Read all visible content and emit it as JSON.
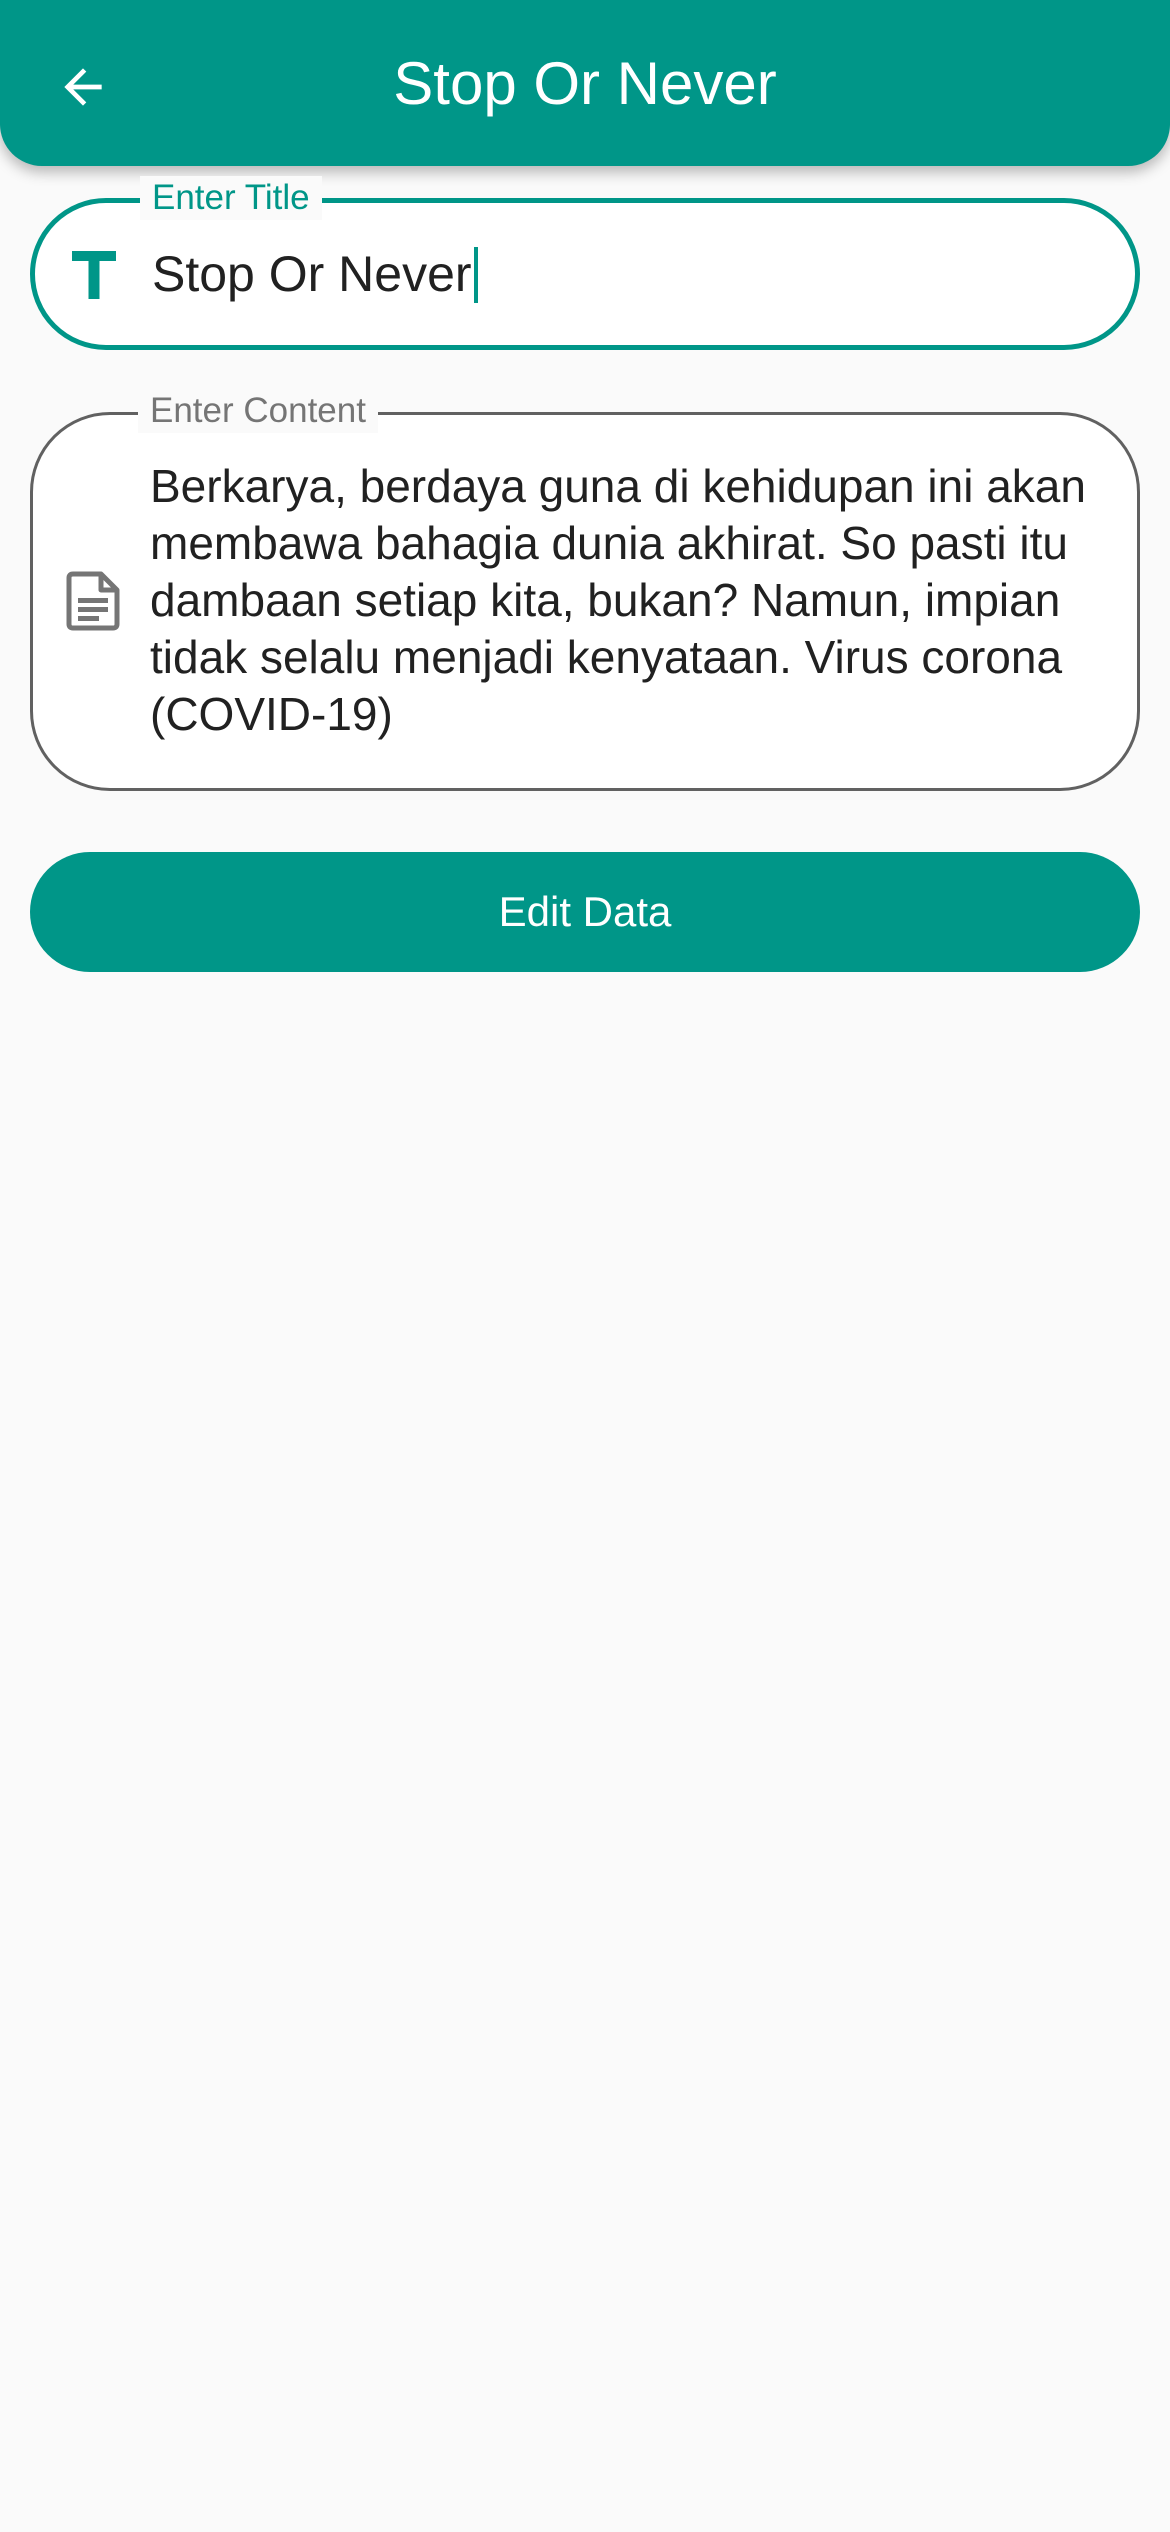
{
  "app_bar": {
    "title": "Stop Or Never",
    "back_icon": "arrow-back-icon",
    "color": "#009688"
  },
  "form": {
    "title_field": {
      "label": "Enter Title",
      "value": "Stop Or Never",
      "icon": "title-t-icon",
      "focused": true
    },
    "content_field": {
      "label": "Enter Content",
      "value": "Berkarya, berdaya guna di kehidupan ini akan membawa bahagia dunia akhirat. So pasti itu dambaan setiap kita, bukan? Namun, impian tidak selalu menjadi kenyataan. Virus corona (COVID-19)",
      "icon": "document-icon"
    },
    "submit_label": "Edit Data"
  }
}
